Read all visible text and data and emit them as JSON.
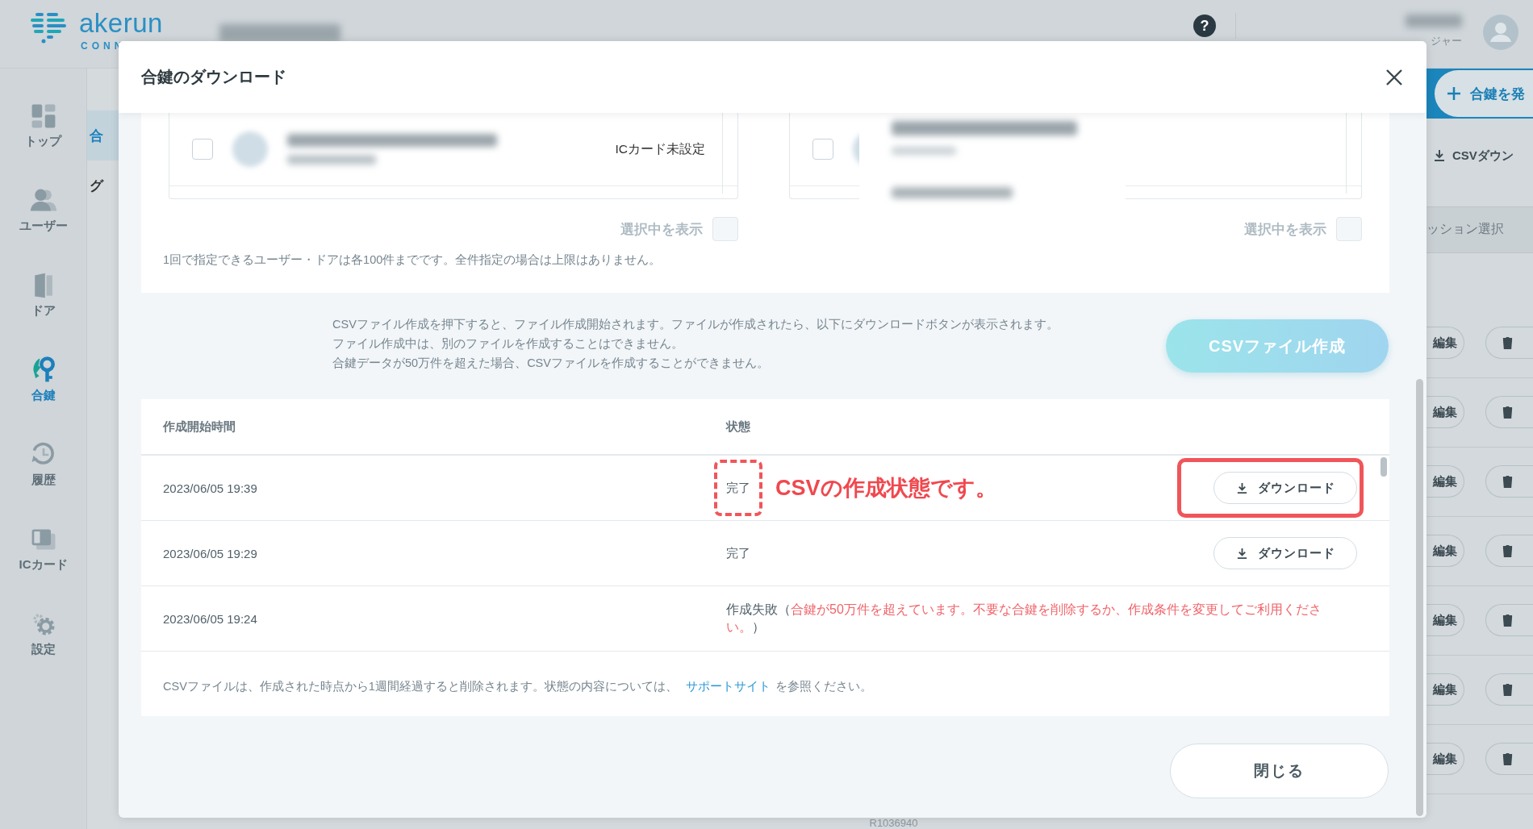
{
  "header": {
    "logo_word": "akerun",
    "logo_sub": "CONN",
    "help": "?",
    "user_role": "ジャー"
  },
  "sidebar": {
    "items": [
      {
        "kind": "top",
        "label": "トップ",
        "selected": false
      },
      {
        "kind": "user",
        "label": "ユーザー",
        "selected": false
      },
      {
        "kind": "door",
        "label": "ドア",
        "selected": false
      },
      {
        "kind": "key",
        "label": "合鍵",
        "selected": true
      },
      {
        "kind": "history",
        "label": "履歴",
        "selected": false
      },
      {
        "kind": "card",
        "label": "ICカード",
        "selected": false
      },
      {
        "kind": "settings",
        "label": "設定",
        "selected": false
      }
    ]
  },
  "subnav": {
    "items": [
      {
        "label": "合",
        "selected": true
      },
      {
        "label": "グ",
        "selected": false
      }
    ]
  },
  "side_panel": {
    "add_button": "合鍵を発",
    "csv_link": "CSVダウン",
    "filter_label": "ッション選択",
    "rows": [
      {
        "edit": "編集"
      },
      {
        "edit": "編集"
      },
      {
        "edit": "編集"
      },
      {
        "edit": "編集"
      },
      {
        "edit": "編集"
      },
      {
        "edit": "編集"
      },
      {
        "edit": "編集"
      }
    ]
  },
  "background": {
    "door_code": "R1036940"
  },
  "modal": {
    "title": "合鍵のダウンロード",
    "selection": {
      "lists": [
        {
          "rows": [
            {
              "checked": false,
              "card_status": "ICカード未設定"
            }
          ]
        },
        {
          "rows": [
            {
              "checked": false
            }
          ]
        }
      ],
      "show_selected": [
        {
          "label": "選択中を表示",
          "checked": false
        },
        {
          "label": "選択中を表示",
          "checked": false
        }
      ],
      "note": "1回で指定できるユーザー・ドアは各100件までです。全件指定の場合は上限はありません。"
    },
    "info": [
      "CSVファイル作成を押下すると、ファイル作成開始されます。ファイルが作成されたら、以下にダウンロードボタンが表示されます。",
      "ファイル作成中は、別のファイルを作成することはできません。",
      "合鍵データが50万件を超えた場合、CSVファイルを作成することができません。"
    ],
    "create_button": "CSVファイル作成",
    "table": {
      "columns": [
        "作成開始時間",
        "状態"
      ],
      "rows": [
        {
          "started": "2023/06/05 19:39",
          "kind": "done",
          "status": "完了",
          "download": "ダウンロード"
        },
        {
          "started": "2023/06/05 19:29",
          "kind": "done",
          "status": "完了",
          "download": "ダウンロード"
        },
        {
          "started": "2023/06/05 19:24",
          "kind": "failed",
          "status": "作成失敗（",
          "error": "合鍵が50万件を超えています。不要な合鍵を削除するか、作成条件を変更してご利用ください。",
          "status_end": "）"
        }
      ]
    },
    "footer_note": {
      "before": "CSVファイルは、作成された時点から1週間経過すると削除されます。状態の内容については、",
      "link": "サポートサイト",
      "after": "を参照ください。"
    },
    "close_button": "閉じる"
  },
  "annotation": {
    "text": "CSVの作成状態です。"
  }
}
